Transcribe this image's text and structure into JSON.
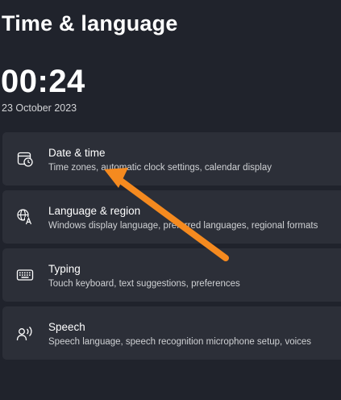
{
  "header": {
    "title": "Time & language"
  },
  "clock": {
    "time": "00:24",
    "date": "23 October 2023"
  },
  "cards": [
    {
      "title": "Date & time",
      "description": "Time zones, automatic clock settings, calendar display",
      "icon": "calendar-clock-icon"
    },
    {
      "title": "Language & region",
      "description": "Windows display language, preferred languages, regional formats",
      "icon": "language-icon"
    },
    {
      "title": "Typing",
      "description": "Touch keyboard, text suggestions, preferences",
      "icon": "keyboard-icon"
    },
    {
      "title": "Speech",
      "description": "Speech language, speech recognition microphone setup, voices",
      "icon": "speech-icon"
    }
  ],
  "colors": {
    "background": "#20232c",
    "card": "#2c2f38",
    "annotation_arrow": "#f58a1f"
  }
}
